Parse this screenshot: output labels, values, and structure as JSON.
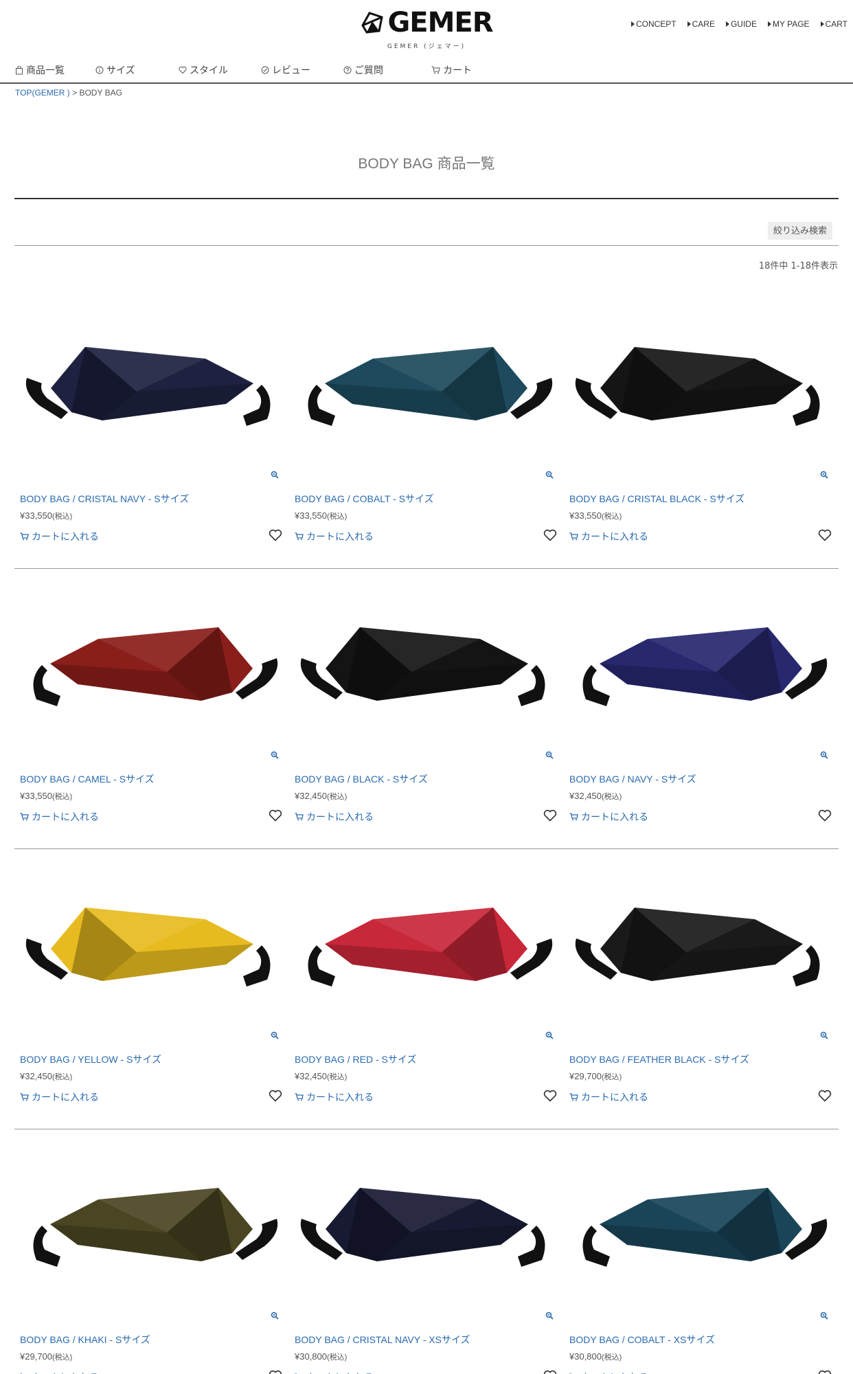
{
  "brand": {
    "logo_text": "GEMER",
    "logo_sub": "GEMER (ジェマー)"
  },
  "top_nav": [
    {
      "label": "CONCEPT"
    },
    {
      "label": "CARE"
    },
    {
      "label": "GUIDE"
    },
    {
      "label": "MY PAGE"
    },
    {
      "label": "CART"
    }
  ],
  "sub_nav": [
    {
      "label": "商品一覧",
      "icon": "bag-icon"
    },
    {
      "label": "サイズ",
      "icon": "info-icon"
    },
    {
      "label": "スタイル",
      "icon": "heart-icon"
    },
    {
      "label": "レビュー",
      "icon": "check-circle-icon"
    },
    {
      "label": "ご質問",
      "icon": "question-icon"
    },
    {
      "label": "カート",
      "icon": "cart-icon"
    }
  ],
  "breadcrumb": {
    "home": "TOP(GEMER )",
    "separator": " > ",
    "current": "BODY BAG"
  },
  "page_title": "BODY BAG 商品一覧",
  "filter_button": "絞り込み検索",
  "result_count": "18件中 1-18件表示",
  "cart_label": "カートに入れる",
  "tax_label": "(税込)",
  "products": [
    {
      "name": "BODY BAG / CRISTAL NAVY - Sサイズ",
      "price": "¥33,550",
      "color": "#1e2140"
    },
    {
      "name": "BODY BAG / COBALT - Sサイズ",
      "price": "¥33,550",
      "color": "#1d4a5c"
    },
    {
      "name": "BODY BAG / CRISTAL BLACK - Sサイズ",
      "price": "¥33,550",
      "color": "#151515"
    },
    {
      "name": "BODY BAG / CAMEL - Sサイズ",
      "price": "¥33,550",
      "color": "#8a1e1a"
    },
    {
      "name": "BODY BAG / BLACK - Sサイズ",
      "price": "¥32,450",
      "color": "#141414"
    },
    {
      "name": "BODY BAG / NAVY - Sサイズ",
      "price": "¥32,450",
      "color": "#27286e"
    },
    {
      "name": "BODY BAG / YELLOW - Sサイズ",
      "price": "¥32,450",
      "color": "#e7bb1f"
    },
    {
      "name": "BODY BAG / RED - Sサイズ",
      "price": "¥32,450",
      "color": "#c8283a"
    },
    {
      "name": "BODY BAG / FEATHER BLACK - Sサイズ",
      "price": "¥29,700",
      "color": "#1a1a1a"
    },
    {
      "name": "BODY BAG / KHAKI - Sサイズ",
      "price": "¥29,700",
      "color": "#4a4522"
    },
    {
      "name": "BODY BAG / CRISTAL NAVY - XSサイズ",
      "price": "¥30,800",
      "color": "#181a33"
    },
    {
      "name": "BODY BAG / COBALT - XSサイズ",
      "price": "¥30,800",
      "color": "#1a4559"
    }
  ],
  "colors": {
    "link": "#2a6bb0",
    "text": "#333333"
  }
}
